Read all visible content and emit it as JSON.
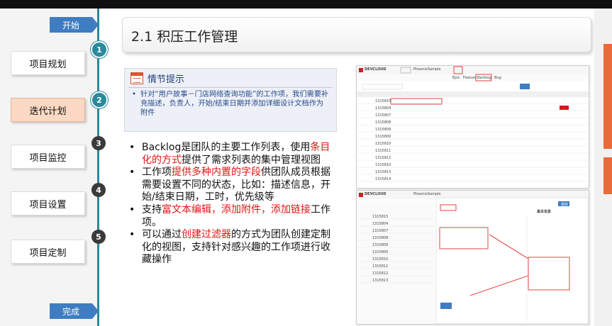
{
  "timeline": {
    "start": "开始",
    "end": "完成",
    "steps": [
      {
        "label": "项目规划",
        "num": "1"
      },
      {
        "label": "迭代计划",
        "num": "2"
      },
      {
        "label": "项目监控",
        "num": "3"
      },
      {
        "label": "项目设置",
        "num": "4"
      },
      {
        "label": "项目定制",
        "num": "5"
      }
    ]
  },
  "title": "2.1 积压工作管理",
  "tip": {
    "heading": "情节提示",
    "bullet": "•",
    "text": "针对“用户故事－门店网络查询功能”的工作项，我们需要补充描述，负责人，开始/结束日期并添加详细设计文档作为附件"
  },
  "bullets": [
    {
      "parts": [
        {
          "t": "Backlog是团队的主要工作列表，使用"
        },
        {
          "t": "条目化的方式",
          "red": true
        },
        {
          "t": "提供了需求列表的集中管理视图"
        }
      ]
    },
    {
      "parts": [
        {
          "t": "工作项"
        },
        {
          "t": "提供多种内置的字段",
          "red": true
        },
        {
          "t": "供团队成员根据需要设置不同的状态，比如：描述信息，开始/结束日期，工时，优先级等"
        }
      ]
    },
    {
      "parts": [
        {
          "t": "支持"
        },
        {
          "t": "富文本编辑，添加附件，添加链接",
          "red": true
        },
        {
          "t": "工作项。"
        }
      ]
    },
    {
      "parts": [
        {
          "t": "可以通过"
        },
        {
          "t": "创建过滤器",
          "red": true
        },
        {
          "t": "的方式为团队创建定制化的视图，支持针对感兴趣的工作项进行收藏操作"
        }
      ]
    }
  ],
  "screenshots": {
    "top": {
      "brand": "DEVCLOUD",
      "project": "PhoenixSample",
      "tab_backlog": "Backlog",
      "tab_epic": "Epic",
      "tab_feature": "Feature",
      "tab_bug": "Bug",
      "ids": [
        "1315815",
        "1315804",
        "1315807",
        "1315808",
        "1315809",
        "1315800",
        "1315810",
        "1315811",
        "1315812",
        "1315810",
        "1315813",
        "1315814"
      ]
    },
    "bottom": {
      "brand": "DEVCLOUD",
      "project": "PhoenixSample",
      "save_button": "保存",
      "basic_info": "基本信息",
      "ids": [
        "1315815",
        "1315804",
        "1315807",
        "1315808",
        "1315809",
        "1315800",
        "1315810",
        "1315811",
        "1315812",
        "1315813"
      ]
    }
  },
  "colors": {
    "accent_teal": "#2a8a9a",
    "button_blue": "#3e7dc2",
    "highlight_red": "#e01515",
    "active_step": "#fbd9c4"
  }
}
